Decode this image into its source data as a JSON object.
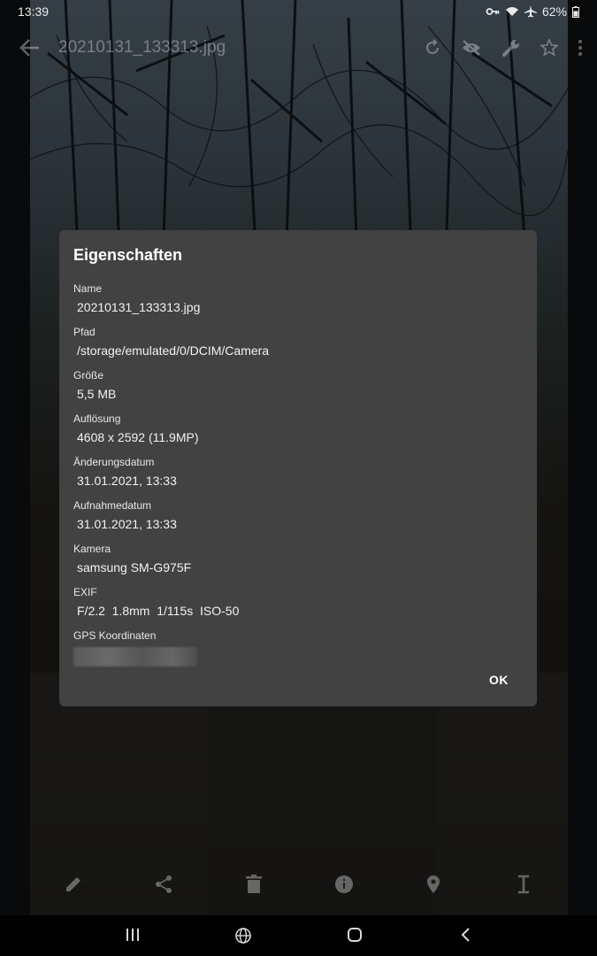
{
  "status_bar": {
    "time": "13:39",
    "battery": "62%",
    "icons": [
      "vpn-key-icon",
      "wifi-icon",
      "airplane-icon",
      "battery-icon"
    ]
  },
  "top_bar": {
    "title": "20210131_133313.jpg",
    "actions": [
      "rotate-icon",
      "hide-icon",
      "edit-tools-icon",
      "star-icon",
      "more-icon"
    ]
  },
  "dialog": {
    "title": "Eigenschaften",
    "properties": [
      {
        "label": "Name",
        "value": "20210131_133313.jpg"
      },
      {
        "label": "Pfad",
        "value": "/storage/emulated/0/DCIM/Camera"
      },
      {
        "label": "Größe",
        "value": "5,5 MB"
      },
      {
        "label": "Auflösung",
        "value": "4608 x 2592 (11.9MP)"
      },
      {
        "label": "Änderungsdatum",
        "value": "31.01.2021, 13:33"
      },
      {
        "label": "Aufnahmedatum",
        "value": "31.01.2021, 13:33"
      },
      {
        "label": "Kamera",
        "value": "samsung SM-G975F"
      },
      {
        "label": "EXIF",
        "value": "F/2.2  1.8mm  1/115s  ISO-50"
      },
      {
        "label": "GPS Koordinaten",
        "value": ""
      }
    ],
    "ok_label": "OK"
  },
  "bottom_actions": [
    "pencil-icon",
    "share-icon",
    "trash-icon",
    "info-icon",
    "location-icon",
    "text-cursor-icon"
  ],
  "nav_bar": [
    "recent-apps-icon",
    "browser-icon",
    "home-icon",
    "back-icon"
  ],
  "colors": {
    "dialog_bg": "#424242",
    "nav_bg": "#000000"
  }
}
